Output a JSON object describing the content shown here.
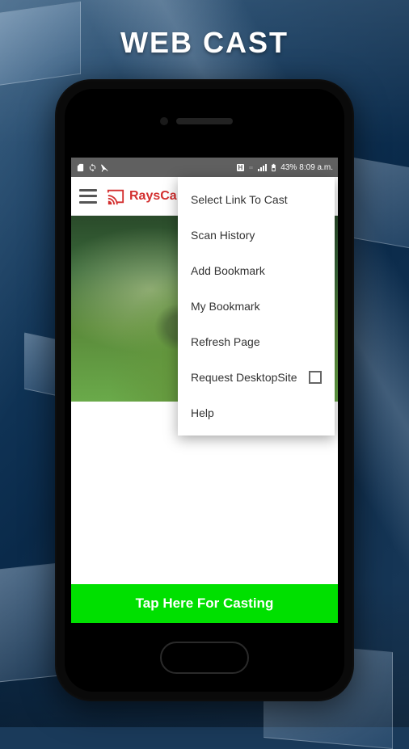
{
  "page_title": "WEB CAST",
  "status_bar": {
    "battery_text": "43%",
    "time": "8:09 a.m.",
    "net_indicator": "H"
  },
  "app": {
    "brand": "RaysCa"
  },
  "menu": {
    "items": [
      {
        "label": "Select Link To Cast"
      },
      {
        "label": "Scan History"
      },
      {
        "label": "Add Bookmark"
      },
      {
        "label": "My Bookmark"
      },
      {
        "label": "Refresh Page"
      },
      {
        "label": "Request DesktopSite",
        "checkbox": true
      },
      {
        "label": "Help"
      }
    ]
  },
  "cast_button": "Tap Here For Casting"
}
